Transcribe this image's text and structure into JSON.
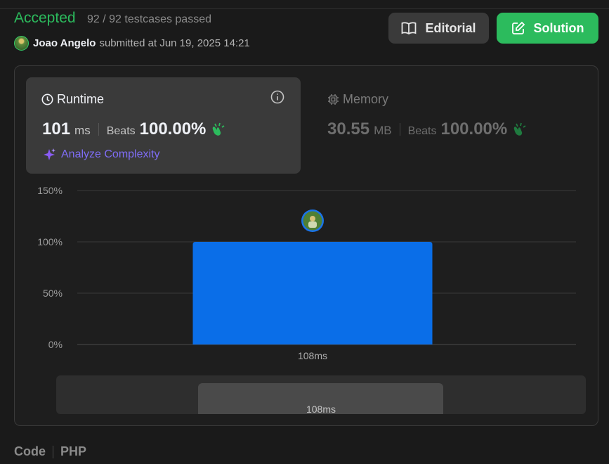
{
  "status": {
    "title": "Accepted",
    "testcases": "92 / 92 testcases passed"
  },
  "submission": {
    "author": "Joao Angelo",
    "meta": "submitted at Jun 19, 2025 14:21"
  },
  "buttons": {
    "editorial": "Editorial",
    "solution": "Solution"
  },
  "runtime": {
    "title": "Runtime",
    "value": "101",
    "unit": "ms",
    "beats_label": "Beats",
    "beats_pct": "100.00%",
    "analyze": "Analyze Complexity"
  },
  "memory": {
    "title": "Memory",
    "value": "30.55",
    "unit": "MB",
    "beats_label": "Beats",
    "beats_pct": "100.00%"
  },
  "chart_data": {
    "type": "bar",
    "categories": [
      "108ms"
    ],
    "values": [
      100
    ],
    "ylim": [
      0,
      150
    ],
    "yticks": [
      "0%",
      "50%",
      "100%",
      "150%"
    ],
    "ytick_values": [
      0,
      50,
      100,
      150
    ],
    "grid": true,
    "bar_color": "#0a6ee8",
    "marker": "user avatar above bar"
  },
  "navigator": {
    "label": "108ms"
  },
  "footer": {
    "code": "Code",
    "language": "PHP"
  },
  "colors": {
    "accent": "#2cbb5d",
    "bar": "#0a6ee8",
    "analyze": "#7f6df6"
  }
}
